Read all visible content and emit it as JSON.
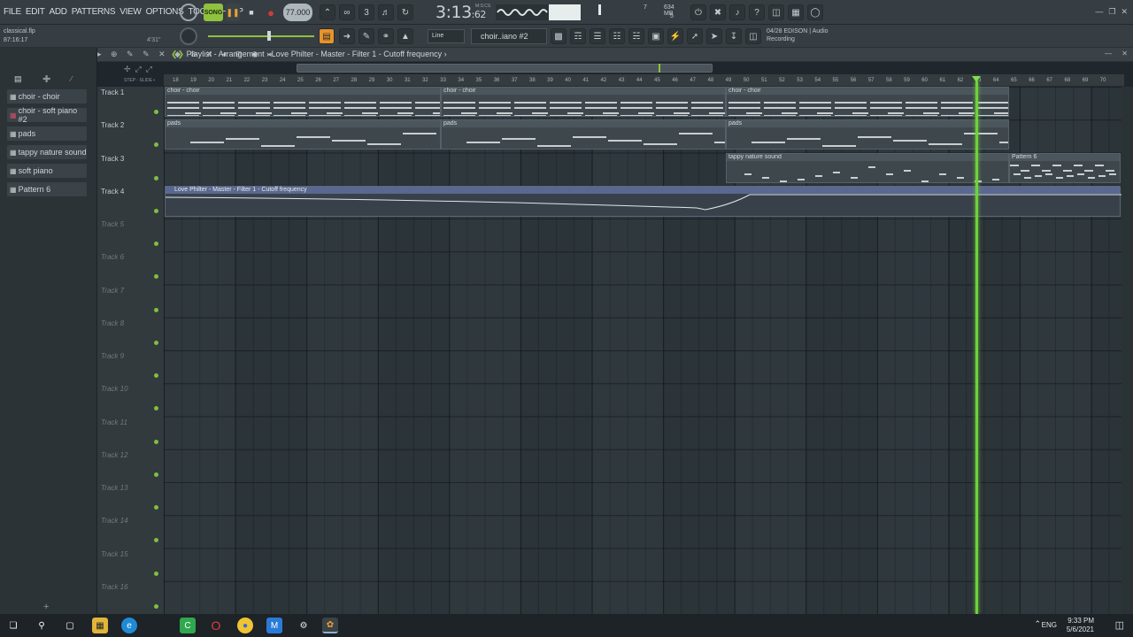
{
  "menu": [
    "FILE",
    "EDIT",
    "ADD",
    "PATTERNS",
    "VIEW",
    "OPTIONS",
    "TOOLS",
    "HELP"
  ],
  "transport": {
    "mode": "SONG",
    "tempo": "77.000",
    "time": "3:13",
    "time_small": ":62",
    "time_label": "M:S:CS"
  },
  "cpu": {
    "value1": "7",
    "mem": "634 MB",
    "value2": "5"
  },
  "file": {
    "name": "classical.flp",
    "time": "87:16:17",
    "right": "4'31\""
  },
  "snap": "Line",
  "pattern_selector": "choir..iano #2",
  "recording_hint": {
    "line1": "04/28  EDISON | Audio",
    "line2": "Recording"
  },
  "playlist": {
    "title": "Playlist - Arrangement",
    "path": "Love Philter - Master - Filter 1 - Cutoff frequency"
  },
  "browser_items": [
    "choir - choir",
    "choir - soft piano #2",
    "pads",
    "tappy nature sound",
    "soft piano",
    "Pattern 6"
  ],
  "ruler": [
    "18",
    "19",
    "20",
    "21",
    "22",
    "23",
    "24",
    "25",
    "26",
    "27",
    "28",
    "29",
    "30",
    "31",
    "32",
    "33",
    "34",
    "35",
    "36",
    "37",
    "38",
    "39",
    "40",
    "41",
    "42",
    "43",
    "44",
    "45",
    "46",
    "47",
    "48",
    "49",
    "50",
    "51",
    "52",
    "53",
    "54",
    "55",
    "56",
    "57",
    "58",
    "59",
    "60",
    "61",
    "62",
    "63",
    "64",
    "65",
    "66",
    "67",
    "68",
    "69",
    "70"
  ],
  "tracks": [
    "Track 1",
    "Track 2",
    "Track 3",
    "Track 4",
    "Track 5",
    "Track 6",
    "Track 7",
    "Track 8",
    "Track 9",
    "Track 10",
    "Track 11",
    "Track 12",
    "Track 13",
    "Track 14",
    "Track 15",
    "Track 16"
  ],
  "clips": {
    "choir1": "choir - choir",
    "choir2": "choir - choir",
    "choir3": "choir - choir",
    "pads1": "pads",
    "pads2": "pads",
    "pads3": "pads",
    "tappy": "tappy nature sound",
    "pattern6": "Pattern 6"
  },
  "automation_label": "Love Philter - Master - Filter 1 - Cutoff frequency",
  "system": {
    "lang": "ENG",
    "time": "9:33 PM",
    "date": "5/6/2021"
  },
  "colors": {
    "playhead": "#6fd13b",
    "accent": "#f0a030",
    "record": "#d23b3b"
  }
}
